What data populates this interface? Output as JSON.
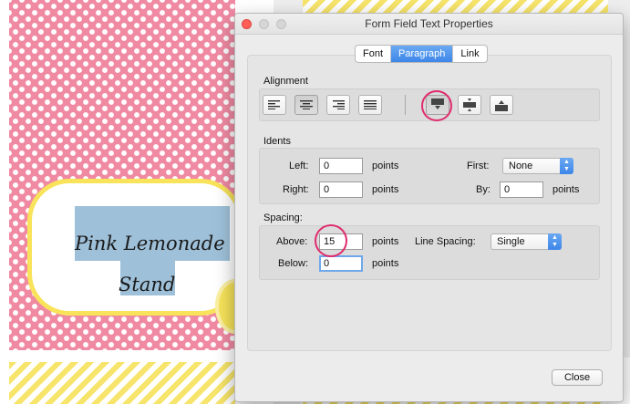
{
  "background": {
    "label_line1": "Pink Lemonade",
    "label_line2": "Stand"
  },
  "dialog": {
    "title": "Form Field Text Properties",
    "tabs": [
      {
        "label": "Font",
        "active": false
      },
      {
        "label": "Paragraph",
        "active": true
      },
      {
        "label": "Link",
        "active": false
      }
    ],
    "alignment": {
      "label": "Alignment",
      "buttons": [
        "align-left",
        "align-center",
        "align-right",
        "justify",
        "align-top",
        "align-middle",
        "align-bottom"
      ],
      "selected_horizontal": "align-center",
      "selected_vertical": "align-top"
    },
    "indents": {
      "label": "Idents",
      "left_label": "Left:",
      "left_value": "0",
      "left_unit": "points",
      "right_label": "Right:",
      "right_value": "0",
      "right_unit": "points",
      "first_label": "First:",
      "first_value": "None",
      "by_label": "By:",
      "by_value": "0",
      "by_unit": "points"
    },
    "spacing": {
      "label": "Spacing:",
      "above_label": "Above:",
      "above_value": "15",
      "above_unit": "points",
      "below_label": "Below:",
      "below_value": "0",
      "below_unit": "points",
      "line_spacing_label": "Line Spacing:",
      "line_spacing_value": "Single"
    },
    "close_label": "Close"
  },
  "colors": {
    "accent": "#3d86e9",
    "highlight_circle": "#e02b6d",
    "pink_background": "#f08aa3",
    "yellow": "#f7e46a"
  }
}
